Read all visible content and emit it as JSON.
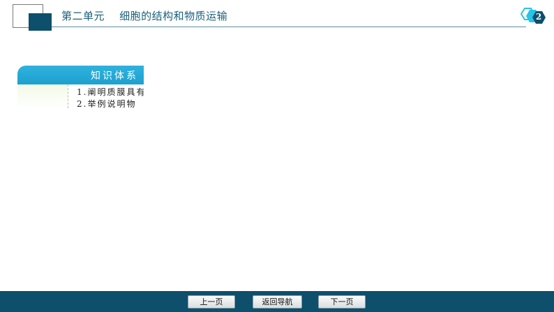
{
  "header": {
    "title": "第二单元    细胞的结构和物质运输",
    "page_number": "2"
  },
  "knowledge_box": {
    "tab_label": "知识体系",
    "lines": [
      "1.阐明质膜具有",
      "2.举例说明物"
    ]
  },
  "nav": {
    "prev_label": "上一页",
    "home_label": "返回导航",
    "next_label": "下一页"
  },
  "colors": {
    "header_bar": "#0e4f6b",
    "accent_blue": "#1ea0cf",
    "badge_cyan": "#26c4e6"
  }
}
